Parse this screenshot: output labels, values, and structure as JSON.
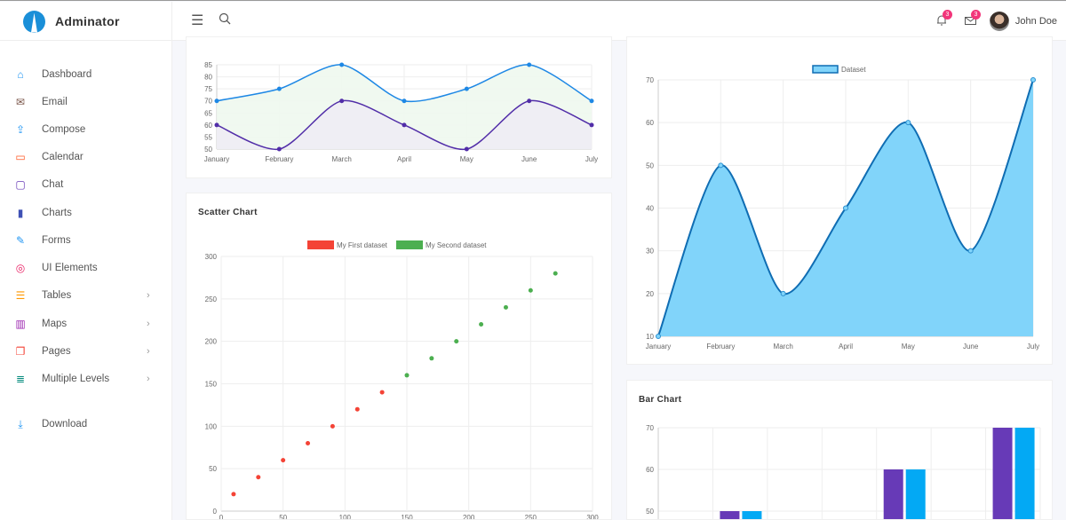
{
  "header": {
    "brand": "Adminator",
    "menu_icon": "hamburger-icon",
    "search_icon": "search-icon",
    "notifications": {
      "icon": "bell-icon",
      "count": "3"
    },
    "messages": {
      "icon": "mail-icon",
      "count": "3"
    },
    "user": {
      "name": "John Doe"
    }
  },
  "sidebar": {
    "items": [
      {
        "label": "Dashboard",
        "icon": "home-icon",
        "color": "#2196f3"
      },
      {
        "label": "Email",
        "icon": "mail-icon",
        "color": "#795548"
      },
      {
        "label": "Compose",
        "icon": "share-icon",
        "color": "#2196f3"
      },
      {
        "label": "Calendar",
        "icon": "calendar-icon",
        "color": "#ff5722"
      },
      {
        "label": "Chat",
        "icon": "chat-icon",
        "color": "#673ab7"
      },
      {
        "label": "Charts",
        "icon": "bar-chart-icon",
        "color": "#3f51b5"
      },
      {
        "label": "Forms",
        "icon": "pencil-icon",
        "color": "#2196f3"
      },
      {
        "label": "UI Elements",
        "icon": "palette-icon",
        "color": "#e91e63"
      },
      {
        "label": "Tables",
        "icon": "table-icon",
        "color": "#ff9800",
        "submenu": true
      },
      {
        "label": "Maps",
        "icon": "map-icon",
        "color": "#9c27b0",
        "submenu": true
      },
      {
        "label": "Pages",
        "icon": "files-icon",
        "color": "#f44336",
        "submenu": true
      },
      {
        "label": "Multiple Levels",
        "icon": "layers-icon",
        "color": "#00897b",
        "submenu": true
      },
      {
        "label": "Download",
        "icon": "download-icon",
        "color": "#2196f3"
      }
    ]
  },
  "cards": {
    "scatter_title": "Scatter Chart",
    "bar_title": "Bar Chart"
  },
  "chart_data": [
    {
      "type": "line",
      "categories": [
        "January",
        "February",
        "March",
        "April",
        "May",
        "June",
        "July"
      ],
      "ylim": [
        50,
        85
      ],
      "yticks": [
        50,
        55,
        60,
        65,
        70,
        75,
        80,
        85
      ],
      "grid": true,
      "series": [
        {
          "values": [
            70,
            75,
            85,
            70,
            75,
            85,
            70
          ],
          "color": "#1e88e5",
          "fill": "#eef8ee"
        },
        {
          "values": [
            60,
            50,
            70,
            60,
            50,
            70,
            60
          ],
          "color": "#512da8",
          "fill": "#eeecf4"
        }
      ]
    },
    {
      "type": "scatter",
      "title": "Scatter Chart",
      "xlim": [
        0,
        300
      ],
      "ylim": [
        0,
        300
      ],
      "xticks": [
        0,
        50,
        100,
        150,
        200,
        250,
        300
      ],
      "yticks": [
        0,
        50,
        100,
        150,
        200,
        250,
        300
      ],
      "grid": true,
      "legend": "top",
      "series": [
        {
          "name": "My First dataset",
          "color": "#f44336",
          "points": [
            [
              10,
              20
            ],
            [
              30,
              40
            ],
            [
              50,
              60
            ],
            [
              70,
              80
            ],
            [
              90,
              100
            ],
            [
              110,
              120
            ],
            [
              130,
              140
            ]
          ]
        },
        {
          "name": "My Second dataset",
          "color": "#4caf50",
          "points": [
            [
              150,
              160
            ],
            [
              170,
              180
            ],
            [
              190,
              200
            ],
            [
              210,
              220
            ],
            [
              230,
              240
            ],
            [
              250,
              260
            ],
            [
              270,
              280
            ]
          ]
        }
      ]
    },
    {
      "type": "area",
      "categories": [
        "January",
        "February",
        "March",
        "April",
        "May",
        "June",
        "July"
      ],
      "ylim": [
        10,
        70
      ],
      "yticks": [
        10,
        20,
        30,
        40,
        50,
        60,
        70
      ],
      "grid": true,
      "legend": "top",
      "series": [
        {
          "name": "Dataset",
          "values": [
            10,
            50,
            20,
            40,
            60,
            30,
            70
          ],
          "color": "#0f6db3",
          "fill": "#81d4fa"
        }
      ]
    },
    {
      "type": "bar",
      "title": "Bar Chart",
      "ylim_visible": [
        50,
        70
      ],
      "yticks": [
        50,
        60,
        70
      ],
      "grid": true,
      "series": [
        {
          "color": "#673ab7",
          "values": [
            null,
            50,
            null,
            null,
            60,
            null,
            70
          ]
        },
        {
          "color": "#03a9f4",
          "values": [
            null,
            50,
            null,
            null,
            60,
            null,
            70
          ]
        }
      ]
    }
  ]
}
